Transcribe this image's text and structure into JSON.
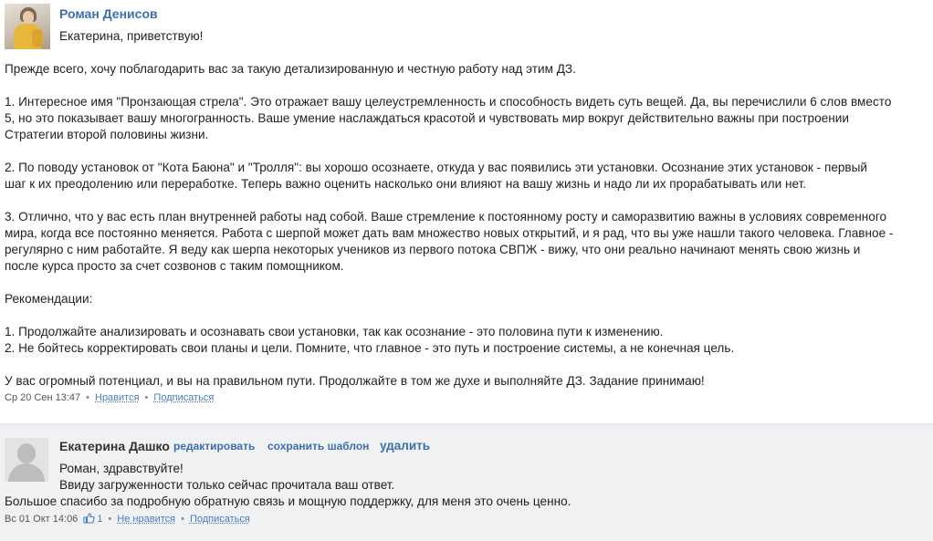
{
  "comment1": {
    "author": "Роман Денисов",
    "greeting": "Екатерина, приветствую!",
    "lines": [
      "Прежде всего, хочу поблагодарить вас за такую детализированную и честную работу над этим ДЗ.",
      "1. Интересное имя \"Пронзающая стрела\". Это отражает вашу целеустремленность и способность видеть суть вещей. Да, вы перечислили 6 слов вместо",
      "5, но это показывает вашу многогранность. Ваше умение наслаждаться красотой и чувствовать мир вокруг действительно важны при построении",
      "Стратегии второй половины жизни.",
      "2. По поводу установок от \"Кота Баюна\" и \"Тролля\": вы хорошо осознаете, откуда у вас появились эти установки. Осознание этих установок - первый",
      "шаг к их преодолению или переработке. Теперь важно оценить насколько они влияют на вашу жизнь и надо ли их прорабатывать или нет.",
      "3. Отлично, что у вас есть план внутренней работы над собой. Ваше стремление к постоянному росту и саморазвитию важны в условиях современного",
      "мира, когда все постоянно меняется. Работа с шерпой может дать вам множество новых открытий, и я рад, что вы уже нашли такого человека. Главное -",
      "регулярно с ним работайте. Я веду как шерпа некоторых учеников из первого потока СВПЖ - вижу, что они реально начинают менять свою жизнь и",
      "после курса просто за счет созвонов с таким помощником.",
      "Рекомендации:",
      "1. Продолжайте анализировать и осознавать свои установки, так как осознание - это половина пути к изменению.",
      "2. Не бойтесь корректировать свои планы и цели. Помните, что главное - это путь и построение системы, а не конечная цель.",
      "У вас огромный потенциал, и вы на правильном пути. Продолжайте в том же духе и выполняйте ДЗ. Задание принимаю!"
    ],
    "meta": {
      "date": "Ср 20 Сен 13:47",
      "like": "Нравится",
      "subscribe": "Подписаться"
    }
  },
  "comment2": {
    "author": "Екатерина Дашко",
    "edit": "редактировать",
    "save_template": "сохранить шаблон",
    "delete": "удалить",
    "lines": [
      "Роман, здравствуйте!",
      "Ввиду загруженности только сейчас прочитала ваш ответ.",
      "Большое спасибо за подробную обратную связь и мощную поддержку, для меня это очень ценно."
    ],
    "meta": {
      "date": "Вс 01 Окт 14:06",
      "likes_count": "1",
      "dislike": "Не нравится",
      "subscribe": "Подписаться"
    }
  }
}
